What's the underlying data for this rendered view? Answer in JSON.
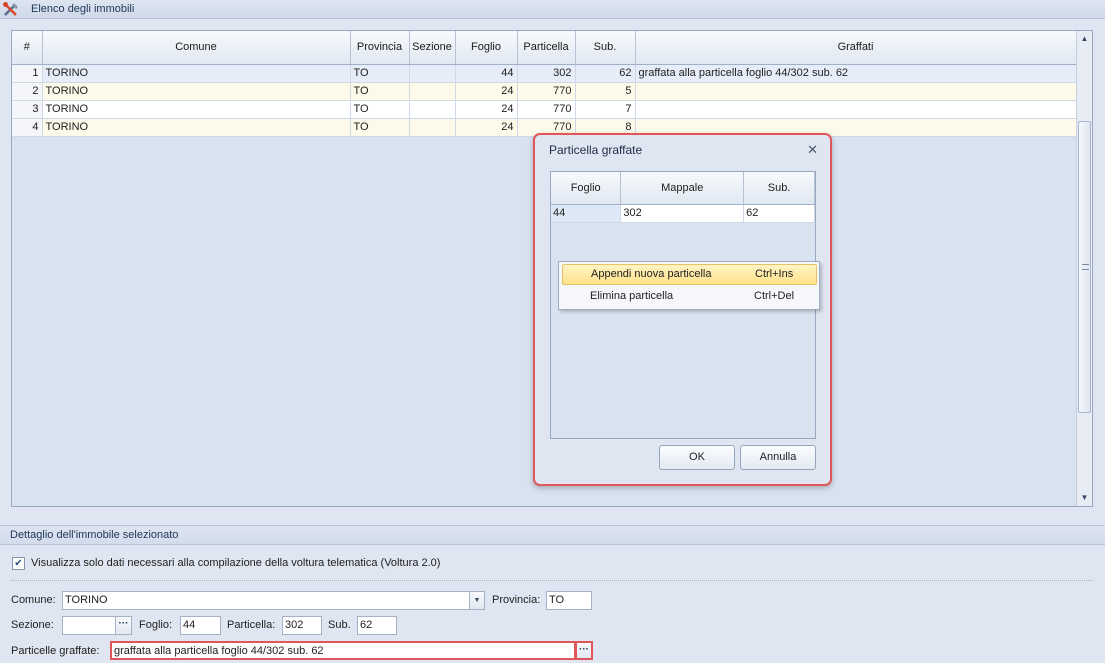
{
  "top_panel": {
    "title": "Elenco degli immobili"
  },
  "grid": {
    "columns": [
      "#",
      "Comune",
      "Provincia",
      "Sezione",
      "Foglio",
      "Particella",
      "Sub.",
      "Graffati"
    ],
    "rows": [
      {
        "n": "1",
        "comune": "TORINO",
        "provincia": "TO",
        "sezione": "",
        "foglio": "44",
        "particella": "302",
        "sub": "62",
        "graffati": "graffata alla particella foglio 44/302 sub. 62"
      },
      {
        "n": "2",
        "comune": "TORINO",
        "provincia": "TO",
        "sezione": "",
        "foglio": "24",
        "particella": "770",
        "sub": "5",
        "graffati": ""
      },
      {
        "n": "3",
        "comune": "TORINO",
        "provincia": "TO",
        "sezione": "",
        "foglio": "24",
        "particella": "770",
        "sub": "7",
        "graffati": ""
      },
      {
        "n": "4",
        "comune": "TORINO",
        "provincia": "TO",
        "sezione": "",
        "foglio": "24",
        "particella": "770",
        "sub": "8",
        "graffati": ""
      }
    ]
  },
  "detail": {
    "title": "Dettaglio dell'immobile selezionato",
    "checkbox_label": "Visualizza solo dati necessari alla compilazione della voltura telematica (Voltura 2.0)",
    "checkbox_checked": true,
    "comune_label": "Comune:",
    "comune_value": "TORINO",
    "provincia_label": "Provincia:",
    "provincia_value": "TO",
    "sezione_label": "Sezione:",
    "sezione_value": "",
    "foglio_label": "Foglio:",
    "foglio_value": "44",
    "particella_label": "Particella:",
    "particella_value": "302",
    "sub_label": "Sub.",
    "sub_value": "62",
    "graffate_label": "Particelle graffate:",
    "graffate_value": "graffata alla particella foglio 44/302 sub. 62",
    "ellipsis": "···"
  },
  "dialog": {
    "title": "Particella graffate",
    "close_glyph": "✕",
    "columns": [
      "Foglio",
      "Mappale",
      "Sub."
    ],
    "rows": [
      {
        "foglio": "44",
        "mappale": "302",
        "sub": "62"
      }
    ],
    "ok_label": "OK",
    "cancel_label": "Annulla"
  },
  "context_menu": {
    "items": [
      {
        "label": "Appendi nuova particella",
        "shortcut": "Ctrl+Ins",
        "highlighted": true
      },
      {
        "label": "Elimina particella",
        "shortcut": "Ctrl+Del",
        "highlighted": false
      }
    ]
  },
  "colors": {
    "highlight_border": "#e0575a",
    "menu_hover": "#ffe28a",
    "alt_row": "#fdfaea"
  }
}
